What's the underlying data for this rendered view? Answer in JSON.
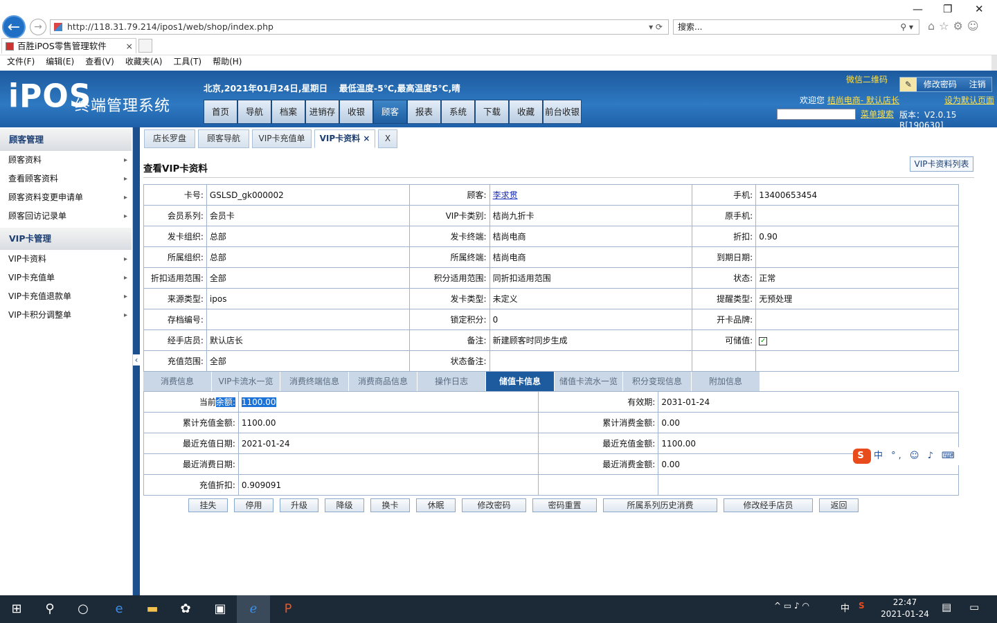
{
  "browser": {
    "url": "http://118.31.79.214/ipos1/web/shop/index.php",
    "search_placeholder": "搜索...",
    "tab_title": "百胜iPOS零售管理软件",
    "menu": [
      "文件(F)",
      "编辑(E)",
      "查看(V)",
      "收藏夹(A)",
      "工具(T)",
      "帮助(H)"
    ]
  },
  "header": {
    "logo": "iPOS",
    "system_name": "终端管理系统",
    "date_info": "北京,2021年01月24日,星期日　 最低温度-5℃,最高温度5℃,晴",
    "nav": [
      "首页",
      "导航",
      "档案",
      "进销存",
      "收银",
      "顾客",
      "报表",
      "系统",
      "下载",
      "收藏",
      "前台收银"
    ],
    "nav_active": "顾客",
    "wechat_qr": "微信二维码",
    "change_pwd": "修改密码",
    "logout": "注销",
    "welcome": "欢迎您",
    "user": "桔尚电商- 默认店长",
    "set_default": "设为默认页面",
    "menu_search": "菜单搜索",
    "version": "版本：V2.0.15 R[190630]"
  },
  "sidebar": {
    "sections": [
      {
        "title": "顾客管理",
        "items": [
          "顾客资料",
          "查看顾客资料",
          "顾客资料变更申请单",
          "顾客回访记录单"
        ]
      },
      {
        "title": "VIP卡管理",
        "items": [
          "VIP卡资料",
          "VIP卡充值单",
          "VIP卡充值退款单",
          "VIP卡积分调整单"
        ]
      }
    ]
  },
  "subtabs": [
    "店长罗盘",
    "顾客导航",
    "VIP卡充值单",
    "VIP卡资料 ×",
    "X"
  ],
  "page": {
    "title": "查看VIP卡资料",
    "list_button": "VIP卡资料列表"
  },
  "card": {
    "rows": [
      [
        "卡号:",
        "GSLSD_gk000002",
        "顾客:",
        "李求贯",
        "手机:",
        "13400653454"
      ],
      [
        "会员系列:",
        "会员卡",
        "VIP卡类别:",
        "桔尚九折卡",
        "原手机:",
        ""
      ],
      [
        "发卡组织:",
        "总部",
        "发卡终端:",
        "桔尚电商",
        "折扣:",
        "0.90"
      ],
      [
        "所属组织:",
        "总部",
        "所属终端:",
        "桔尚电商",
        "到期日期:",
        ""
      ],
      [
        "折扣适用范围:",
        "全部",
        "积分适用范围:",
        " 同折扣适用范围",
        "状态:",
        "正常"
      ],
      [
        "来源类型:",
        " ipos",
        "发卡类型:",
        " 未定义",
        "提醒类型:",
        "无预处理"
      ],
      [
        "存档编号:",
        "",
        "锁定积分:",
        "0",
        "开卡品牌:",
        ""
      ],
      [
        "经手店员:",
        "默认店长",
        "备注:",
        "新建顾客时同步生成",
        "可储值:",
        "✓"
      ],
      [
        "充值范围:",
        "全部",
        "状态备注:",
        "",
        "",
        ""
      ]
    ]
  },
  "info_tabs": [
    "消费信息",
    "VIP卡流水一览",
    "消费终端信息",
    "消费商品信息",
    "操作日志",
    "储值卡信息",
    "储值卡流水一览",
    "积分变现信息",
    "附加信息"
  ],
  "info_tab_active": "储值卡信息",
  "stored": {
    "current_prefix": "当前",
    "current_label": "余额:",
    "current_value": "1100.00",
    "rows": [
      [
        "",
        "",
        "有效期:",
        "2031-01-24"
      ],
      [
        "累计充值金额:",
        "1100.00",
        "累计消费金额:",
        "0.00"
      ],
      [
        "最近充值日期:",
        "2021-01-24",
        "最近充值金额:",
        "1100.00"
      ],
      [
        "最近消费日期:",
        "",
        "最近消费金额:",
        "0.00"
      ],
      [
        "充值折扣:",
        "0.909091",
        "",
        ""
      ]
    ]
  },
  "actions": [
    "挂失",
    "停用",
    "升级",
    "降级",
    "换卡",
    "休眠",
    "修改密码",
    "密码重置",
    "所属系列历史消费",
    "修改经手店员",
    "返回"
  ],
  "ime": "中 °, ☺ ♪ ⌨",
  "taskbar": {
    "time": "22:47",
    "date": "2021-01-24",
    "tray_lang": "中"
  }
}
